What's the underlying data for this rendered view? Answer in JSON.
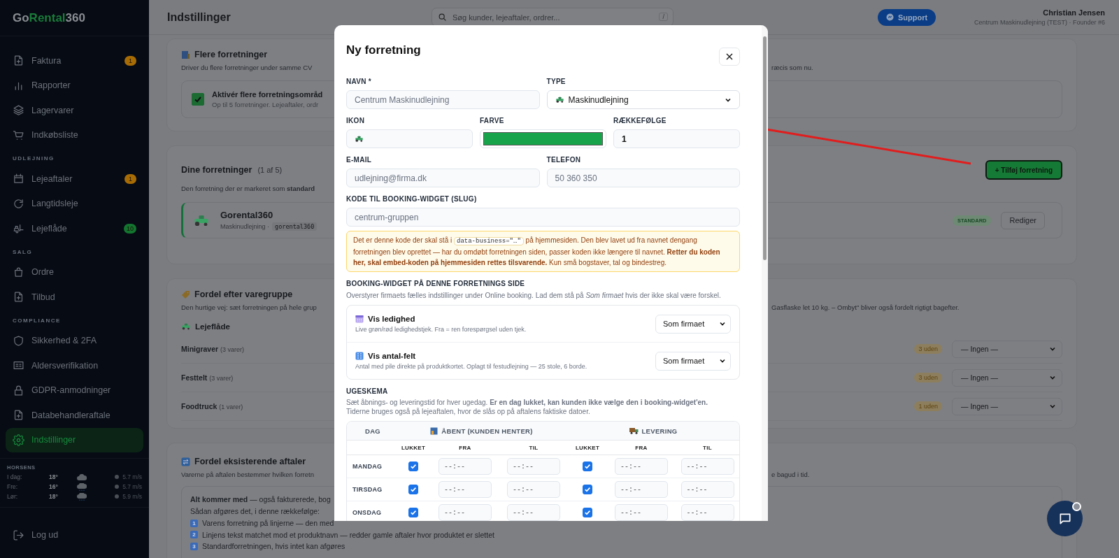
{
  "sidebar": {
    "logo": [
      "Go",
      "Rental",
      "360"
    ],
    "groups": [
      {
        "items": [
          {
            "label": "Faktura",
            "selected": false,
            "badge": {
              "text": "1",
              "color": "#a86c05"
            }
          },
          {
            "label": "Rapporter",
            "selected": false
          },
          {
            "label": "Lagervarer",
            "selected": false
          },
          {
            "label": "Indkøbsliste",
            "selected": false
          }
        ]
      },
      {
        "label": "UDLEJNING",
        "items": [
          {
            "label": "Lejeaftaler",
            "selected": false,
            "badge": {
              "text": "1",
              "color": "#a86c05"
            }
          },
          {
            "label": "Langtidsleje",
            "selected": false
          },
          {
            "label": "Lejeflåde",
            "selected": false,
            "badge": {
              "text": "10",
              "color": "#13752f"
            }
          }
        ]
      },
      {
        "label": "SALG",
        "items": [
          {
            "label": "Ordre",
            "selected": false
          },
          {
            "label": "Tilbud",
            "selected": false
          }
        ]
      },
      {
        "label": "COMPLIANCE",
        "items": [
          {
            "label": "Sikkerhed & 2FA",
            "selected": false
          },
          {
            "label": "Aldersverifikation",
            "selected": false
          },
          {
            "label": "GDPR-anmodninger",
            "selected": false
          },
          {
            "label": "Databehandleraftale",
            "selected": false
          },
          {
            "label": "Indstillinger",
            "selected": true
          }
        ]
      }
    ],
    "weather": {
      "location": "HORSENS",
      "days": [
        {
          "day": "I dag:",
          "temp": "18°",
          "wind": "5.7 m/s"
        },
        {
          "day": "Fre:",
          "temp": "16°",
          "wind": "5.7 m/s"
        },
        {
          "day": "Lør:",
          "temp": "18°",
          "wind": "5.9 m/s"
        }
      ]
    },
    "logout": "Log ud"
  },
  "header": {
    "title": "Indstillinger",
    "search": {
      "placeholder": "Søg kunder, lejeaftaler, ordrer...",
      "shortcut": "/"
    },
    "support": "Support",
    "user": {
      "name": "Christian Jensen",
      "subtitle": "Centrum Maskinudlejning (TEST) · Founder #6"
    }
  },
  "multi_business": {
    "title": "Flere forretninger",
    "description_left": "Driver du flere forretninger under samme CV",
    "description_right": "ræcis som nu.",
    "option": {
      "label": "Aktivér flere forretningsområd",
      "hint": "Op til 5 forretninger. Lejeaftaler, ordr",
      "checked": true
    }
  },
  "businesses": {
    "title": "Dine forretninger",
    "count": "(1 af 5)",
    "description": "Den forretning der er markeret som **standard**",
    "add_button": "+ Tilføj forretning",
    "items": [
      {
        "name": "Gorental360",
        "type": "Maskinudlejning ·",
        "slug": "gorental360",
        "badge": "STANDARD",
        "edit": "Rediger"
      }
    ]
  },
  "by_group": {
    "title": "Fordel efter varegruppe",
    "description_left": "Den hurtige vej: sæt forretningen på hele grup",
    "description_right": "Gasflaske let 10 kg. – Ombyt\" bliver også fordelt rigtigt bagefter.",
    "group": "Lejeflåde",
    "rows": [
      {
        "name": "Minigraver",
        "count": "(3 varer)",
        "missing": "3 uden",
        "value": "— Ingen —"
      },
      {
        "name": "Festtelt",
        "count": "(3 varer)",
        "missing": "3 uden",
        "value": "— Ingen —"
      },
      {
        "name": "Foodtruck",
        "count": "(1 varer)",
        "missing": "1 uden",
        "value": "— Ingen —"
      }
    ]
  },
  "existing": {
    "title": "Fordel eksisterende aftaler",
    "description_left": "Varerne på aftalen bestemmer hvilken forretn",
    "description_right": "e bagud i tid.",
    "intro": "**Alt kommer med** — også fakturerede, bog",
    "order_label": "Sådan afgøres det, i denne rækkefølge:",
    "steps": [
      {
        "number": "1",
        "text": "Varens forretning på linjerne — den med"
      },
      {
        "number": "2",
        "text": "Linjens tekst matchet mod et produktnavn — redder gamle aftaler hvor produktet er slettet"
      },
      {
        "number": "3",
        "text": "Standardforretningen, hvis intet kan afgøres"
      }
    ]
  },
  "modal": {
    "title": "Ny forretning",
    "rows": [
      [
        {
          "kind": "text",
          "label": "NAVN *",
          "placeholder": "Centrum Maskinudlejning"
        },
        {
          "kind": "select",
          "label": "TYPE",
          "value": "Maskinudlejning"
        }
      ],
      [
        {
          "kind": "icon",
          "label": "IKON"
        },
        {
          "kind": "color",
          "label": "FARVE",
          "color": "#16a34a"
        },
        {
          "kind": "text",
          "label": "RÆKKEFØLGE",
          "value": "1"
        }
      ],
      [
        {
          "kind": "text",
          "label": "E-MAIL",
          "placeholder": "udlejning@firma.dk"
        },
        {
          "kind": "text",
          "label": "TELEFON",
          "placeholder": "50 360 350"
        }
      ],
      [
        {
          "kind": "text",
          "label": "KODE TIL BOOKING-WIDGET (SLUG)",
          "placeholder": "centrum-gruppen"
        }
      ]
    ],
    "note": {
      "before": "Det er denne kode der skal stå i",
      "code": "data-business=\"…\"",
      "after": "på hjemmesiden. Den blev lavet ud fra navnet dengang forretningen blev oprettet — har du omdøbt forretningen siden, passer koden ikke længere til navnet. **Retter du koden her, skal embed-koden på hjemmesiden rettes tilsvarende.** Kun små bogstaver, tal og bindestreg."
    },
    "widget": {
      "heading": "BOOKING-WIDGET PÅ DENNE FORRETNINGS SIDE",
      "description": "Overstyrer firmaets fælles indstillinger under Online booking. Lad dem stå på *Som firmaet* hvis der ikke skal være forskel.",
      "options": [
        {
          "title": "Vis ledighed",
          "hint": "Live grøn/rød ledighedstjek. Fra = ren forespørgsel uden tjek.",
          "value": "Som firmaet"
        },
        {
          "title": "Vis antal-felt",
          "hint": "Antal med pile direkte på produktkortet. Oplagt til festudlejning — 25 stole, 6 borde.",
          "value": "Som firmaet"
        }
      ]
    },
    "schedule": {
      "heading": "UGESKEMA",
      "description": [
        "Sæt åbnings- og leveringstid for hver ugedag. **Er en dag lukket, kan kunden ikke vælge den i booking-widget'en.**",
        "Tiderne bruges også på lejeaftalen, hvor de slås op på aftalens faktiske datoer."
      ],
      "day_column": "DAG",
      "groups": [
        {
          "title": "ÅBENT (KUNDEN HENTER)",
          "closed": "LUKKET",
          "from": "FRA",
          "to": "TIL"
        },
        {
          "title": "LEVERING",
          "closed": "LUKKET",
          "from": "FRA",
          "to": "TIL"
        }
      ],
      "rows": [
        {
          "day": "MANDAG",
          "slots": [
            {
              "closed": true,
              "from": {
                "placeholder": "--:--"
              },
              "to": {
                "placeholder": "--:--"
              }
            },
            {
              "closed": true,
              "from": {
                "placeholder": "--:--"
              },
              "to": {
                "placeholder": "--:--"
              }
            }
          ]
        },
        {
          "day": "TIRSDAG",
          "slots": [
            {
              "closed": true,
              "from": {
                "placeholder": "--:--"
              },
              "to": {
                "placeholder": "--:--"
              }
            },
            {
              "closed": true,
              "from": {
                "placeholder": "--:--"
              },
              "to": {
                "placeholder": "--:--"
              }
            }
          ]
        },
        {
          "day": "ONSDAG",
          "slots": [
            {
              "closed": true,
              "from": {
                "placeholder": "--:--"
              },
              "to": {
                "placeholder": "--:--"
              }
            },
            {
              "closed": true,
              "from": {
                "placeholder": "--:--"
              },
              "to": {
                "placeholder": "--:--"
              }
            }
          ]
        }
      ]
    }
  }
}
